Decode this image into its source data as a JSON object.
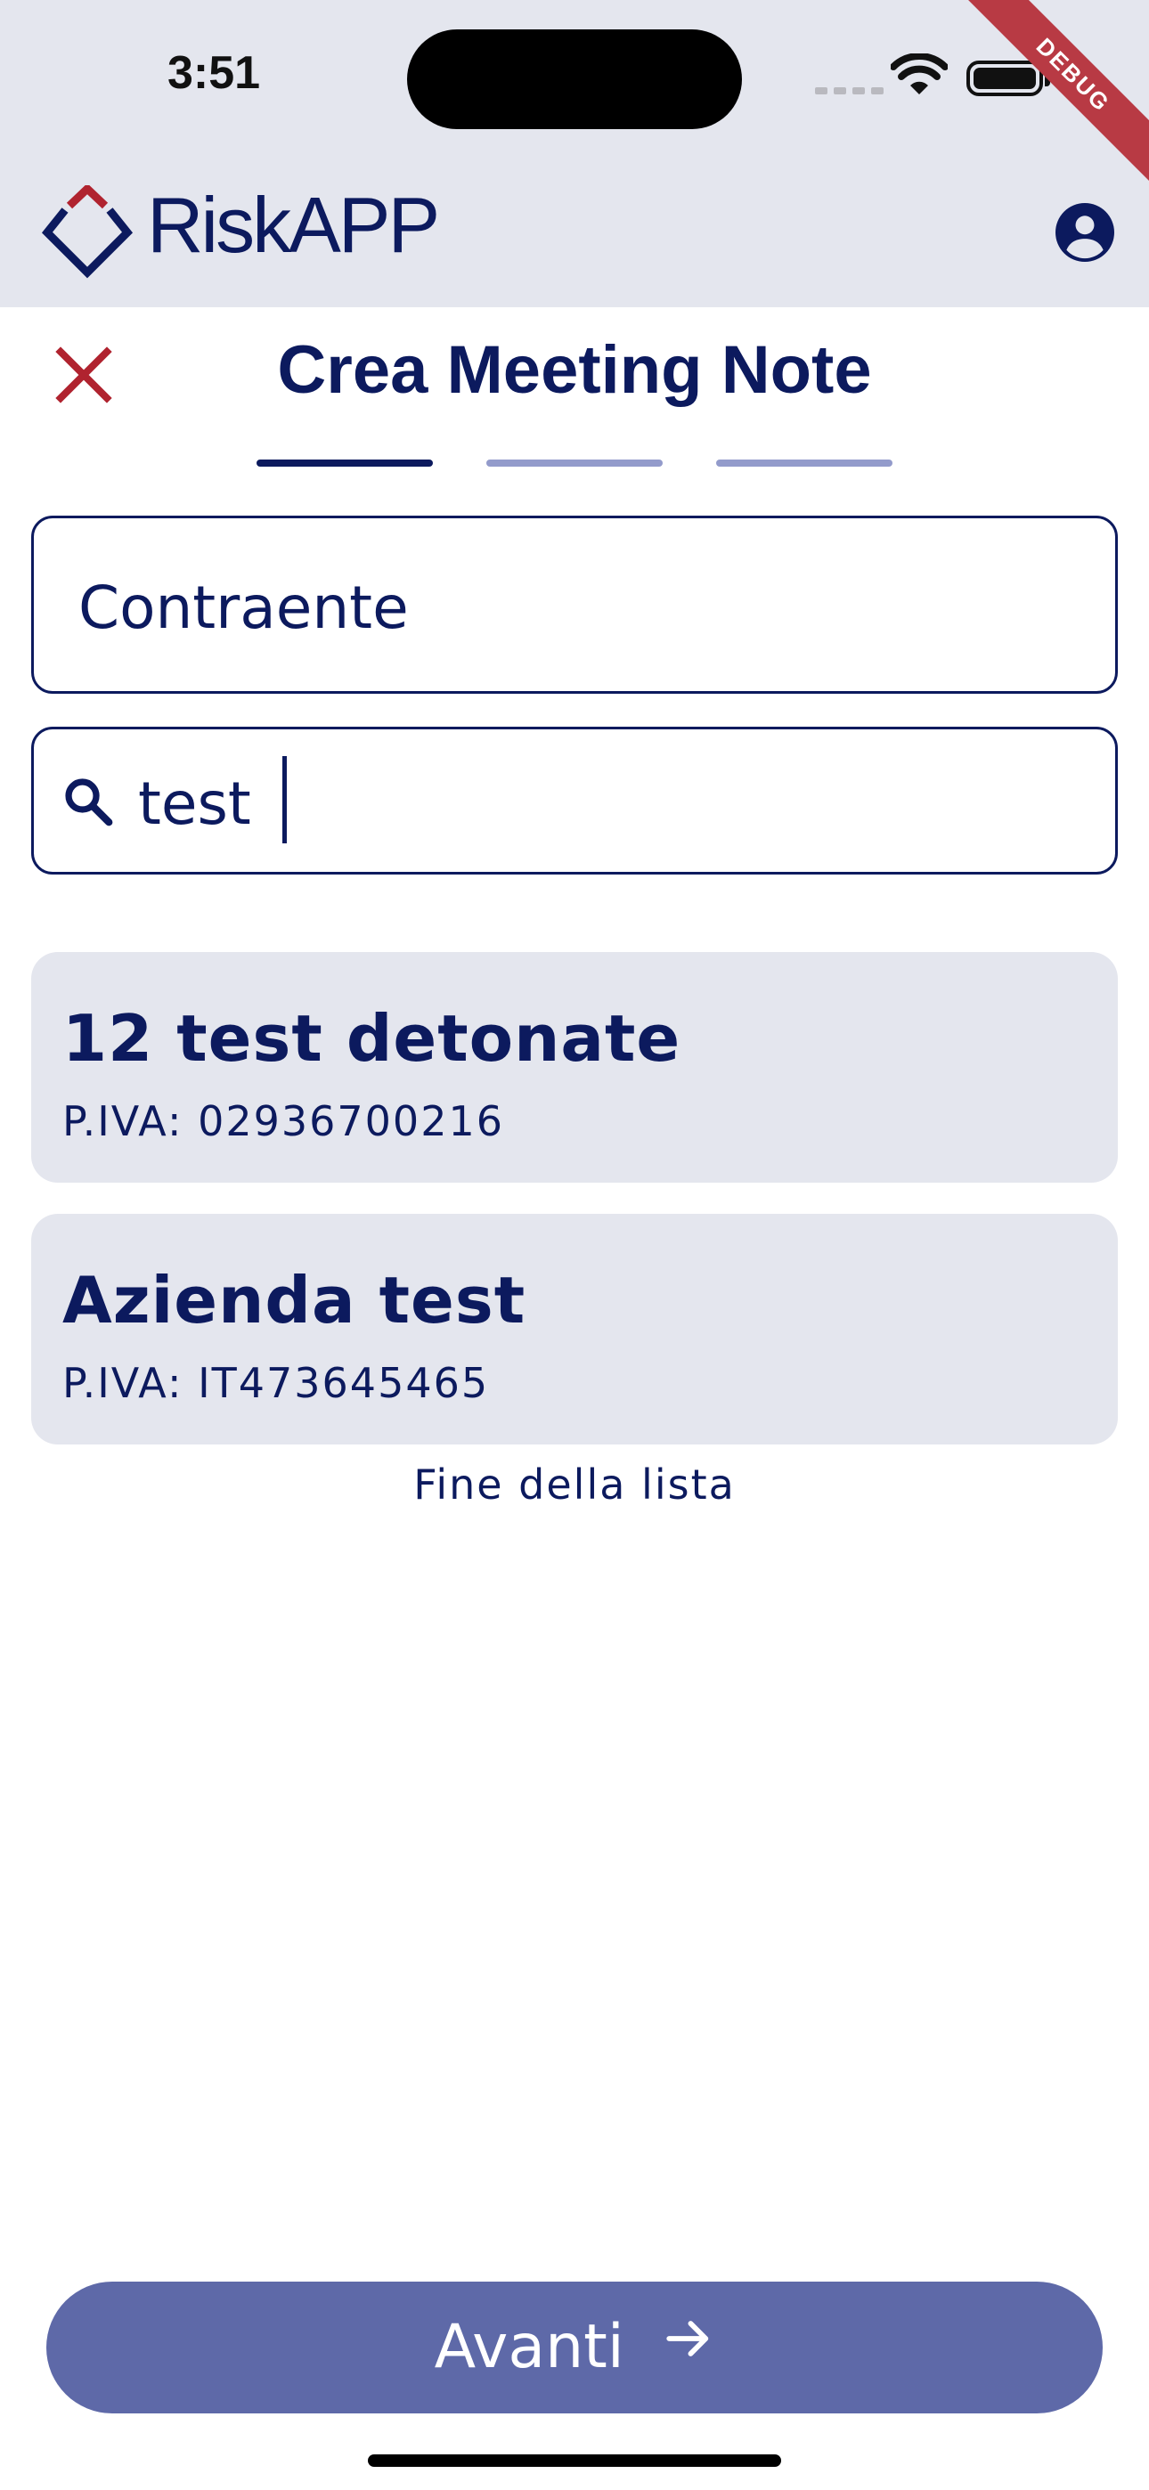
{
  "status_bar": {
    "time": "3:51"
  },
  "debug_banner": "DEBUG",
  "app_bar": {
    "logo_text": "RiskAPP"
  },
  "page": {
    "title": "Crea Meeting Note",
    "steps_total": 3,
    "current_step": 1
  },
  "form": {
    "contraente_label": "Contraente",
    "search_value": "test"
  },
  "results": [
    {
      "name": "12 test detonate",
      "vat": "P.IVA: 02936700216"
    },
    {
      "name": "Azienda test",
      "vat": "P.IVA: IT473645465"
    }
  ],
  "end_of_list": "Fine della lista",
  "footer": {
    "next_label": "Avanti"
  },
  "colors": {
    "primary": "#0c1a5e",
    "accent_red": "#b0232f",
    "surface": "#e4e6ee",
    "button": "#5e69a8",
    "step_inactive": "#939bcb"
  }
}
